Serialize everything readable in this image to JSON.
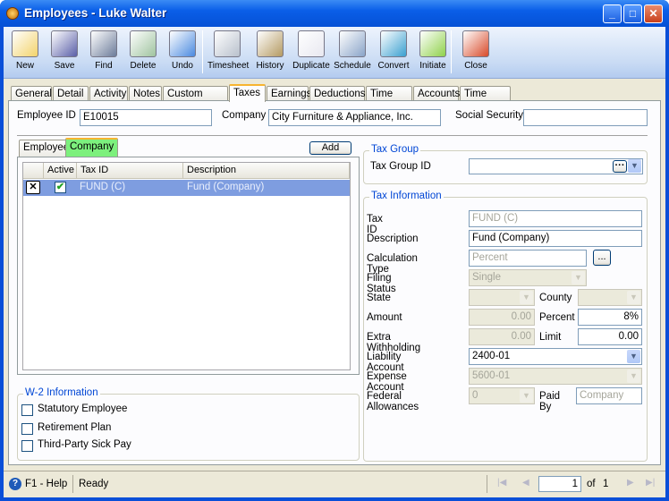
{
  "window": {
    "title": "Employees - Luke  Walter",
    "min": "_",
    "max": "□",
    "close": "✕"
  },
  "toolbar": [
    {
      "label": "New",
      "icon": "new-icon",
      "color": "#f3d36b"
    },
    {
      "label": "Save",
      "icon": "save-icon",
      "color": "#5a5fa8"
    },
    {
      "label": "Find",
      "icon": "binoculars-icon",
      "color": "#6c7c9a"
    },
    {
      "label": "Delete",
      "icon": "recycle-bin-icon",
      "color": "#9fc39f"
    },
    {
      "label": "Undo",
      "icon": "undo-icon",
      "color": "#4a8ae0"
    },
    {
      "label": "Timesheet",
      "icon": "timesheet-icon",
      "color": "#b8c0cc"
    },
    {
      "label": "History",
      "icon": "history-icon",
      "color": "#b49a62"
    },
    {
      "label": "Duplicate",
      "icon": "duplicate-icon",
      "color": "#e8e8f0"
    },
    {
      "label": "Schedule",
      "icon": "schedule-icon",
      "color": "#8aa4c8"
    },
    {
      "label": "Convert",
      "icon": "convert-icon",
      "color": "#3aa0d0"
    },
    {
      "label": "Initiate",
      "icon": "traffic-light-icon",
      "color": "#8fd14a"
    },
    {
      "label": "Close",
      "icon": "close-icon",
      "color": "#d84a2a"
    }
  ],
  "tabs": [
    "General",
    "Detail",
    "Activity",
    "Notes",
    "Custom Fields",
    "Taxes",
    "Earnings",
    "Deductions",
    "Time Off",
    "Accounts",
    "Time Clock"
  ],
  "active_tab": "Taxes",
  "header": {
    "employee_id_label": "Employee ID",
    "employee_id": "E10015",
    "company_label": "Company",
    "company": "City Furniture & Appliance, Inc.",
    "ssn_label": "Social Security",
    "ssn": ""
  },
  "subtabs": {
    "employee": "Employee",
    "company": "Company",
    "add": "Add"
  },
  "grid": {
    "columns": [
      "",
      "Active",
      "Tax ID",
      "Description"
    ],
    "rows": [
      {
        "delete": "✕",
        "active": true,
        "tax_id": "FUND (C)",
        "description": "Fund (Company)"
      }
    ]
  },
  "w2": {
    "title": "W-2 Information",
    "items": [
      {
        "label": "Statutory Employee",
        "checked": false
      },
      {
        "label": "Retirement Plan",
        "checked": false
      },
      {
        "label": "Third-Party Sick Pay",
        "checked": false
      }
    ]
  },
  "tax_group": {
    "title": "Tax Group",
    "id_label": "Tax Group ID",
    "id": "",
    "ellipsis": "···"
  },
  "tax_info": {
    "title": "Tax Information",
    "tax_id_label": "Tax ID",
    "tax_id": "FUND (C)",
    "description_label": "Description",
    "description": "Fund (Company)",
    "calc_type_label": "Calculation Type",
    "calc_type": "Percent",
    "calc_btn": "...",
    "filing_status_label": "Filing Status",
    "filing_status": "Single",
    "state_label": "State",
    "state": "",
    "county_label": "County",
    "county": "",
    "amount_label": "Amount",
    "amount": "0.00",
    "percent_label": "Percent",
    "percent": "8%",
    "extra_label": "Extra Withholding",
    "extra": "0.00",
    "limit_label": "Limit",
    "limit": "0.00",
    "liability_label": "Liability Account",
    "liability": "2400-01",
    "expense_label": "Expense Account",
    "expense": "5600-01",
    "fed_allow_label": "Federal Allowances",
    "fed_allow": "0",
    "paid_by_label": "Paid By",
    "paid_by": "Company"
  },
  "status": {
    "help": "F1 - Help",
    "state": "Ready",
    "page": "1",
    "of": "of",
    "total": "1"
  }
}
